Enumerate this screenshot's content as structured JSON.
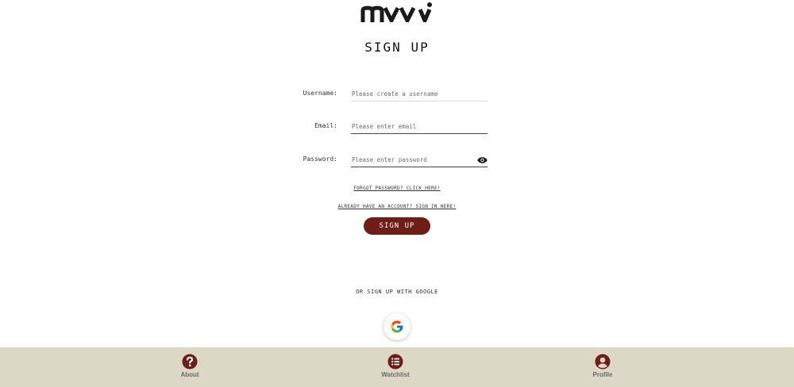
{
  "brand": {
    "logo_text": "mvvi",
    "accent": "#6e1d17",
    "nav_bg": "#dbd8c6"
  },
  "page": {
    "title": "SIGN UP"
  },
  "form": {
    "username": {
      "label": "Username:",
      "placeholder": "Please create a username",
      "value": ""
    },
    "email": {
      "label": "Email:",
      "placeholder": "Please enter email",
      "value": ""
    },
    "password": {
      "label": "Password:",
      "placeholder": "Please enter password",
      "value": "",
      "toggle_icon": "eye-icon"
    },
    "forgot_link": "FORGOT PASSWORD? CLICK HERE!",
    "signin_link": "ALREADY HAVE AN ACCOUNT? SIGN IN HERE!",
    "submit_label": "SIGN UP"
  },
  "social": {
    "or_text": "OR SIGN UP WITH GOOGLE",
    "google_icon": "google-icon"
  },
  "bottom_nav": {
    "items": [
      {
        "label": "About",
        "icon": "question-circle-icon"
      },
      {
        "label": "Watchlist",
        "icon": "list-circle-icon"
      },
      {
        "label": "Profile",
        "icon": "user-circle-icon"
      }
    ]
  }
}
